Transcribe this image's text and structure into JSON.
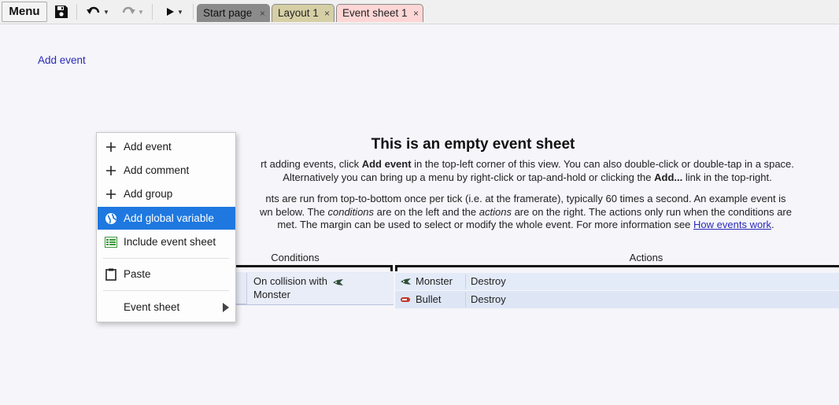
{
  "toolbar": {
    "menu_label": "Menu",
    "icons": [
      "save-icon",
      "undo-icon",
      "redo-icon",
      "play-icon"
    ]
  },
  "tabs": [
    {
      "label": "Start page",
      "close": "×"
    },
    {
      "label": "Layout 1",
      "close": "×"
    },
    {
      "label": "Event sheet 1",
      "close": "×"
    }
  ],
  "sheet": {
    "add_event_link": "Add event",
    "title": "This is an empty event sheet",
    "para1": {
      "l1_a": "rt adding events, click ",
      "l1_b": "Add event",
      "l1_c": " in the top-left corner of this view. You can also double-click or double-tap in a space.",
      "l2_a": "Alternatively you can bring up a menu by right-click or tap-and-hold or clicking the ",
      "l2_b": "Add...",
      "l2_c": " link in the top-right."
    },
    "para2": {
      "l1": "nts are run from top-to-bottom once per tick (i.e. at the framerate), typically 60 times a second. An example event is",
      "l2_a": "wn below. The ",
      "l2_b": "conditions",
      "l2_c": " are on the left and the ",
      "l2_d": "actions",
      "l2_e": " are on the right. The actions only run when the conditions are",
      "l3_a": "met. The margin can be used to select or modify the whole event. For more information see ",
      "l3_link": "How events work",
      "l3_b": "."
    },
    "example": {
      "conditions_header": "Conditions",
      "actions_header": "Actions",
      "condition_line1": "On collision with",
      "condition_line2": "Monster",
      "actions": [
        {
          "object": "Monster",
          "action": "Destroy",
          "icon": "monster-icon"
        },
        {
          "object": "Bullet",
          "action": "Destroy",
          "icon": "bullet-icon"
        }
      ]
    }
  },
  "context_menu": {
    "items": [
      {
        "label": "Add event",
        "icon": "plus-icon"
      },
      {
        "label": "Add comment",
        "icon": "plus-icon"
      },
      {
        "label": "Add group",
        "icon": "plus-icon"
      },
      {
        "label": "Add global variable",
        "icon": "globe-icon",
        "active": true
      },
      {
        "label": "Include event sheet",
        "icon": "event-sheet-icon"
      },
      {
        "label": "Paste",
        "icon": "clipboard-icon"
      },
      {
        "label": "Event sheet",
        "icon": "",
        "submenu": true
      }
    ]
  },
  "colors": {
    "accent": "#1e78e0",
    "link": "#2a2ab8",
    "background": "#f5f5fa"
  }
}
